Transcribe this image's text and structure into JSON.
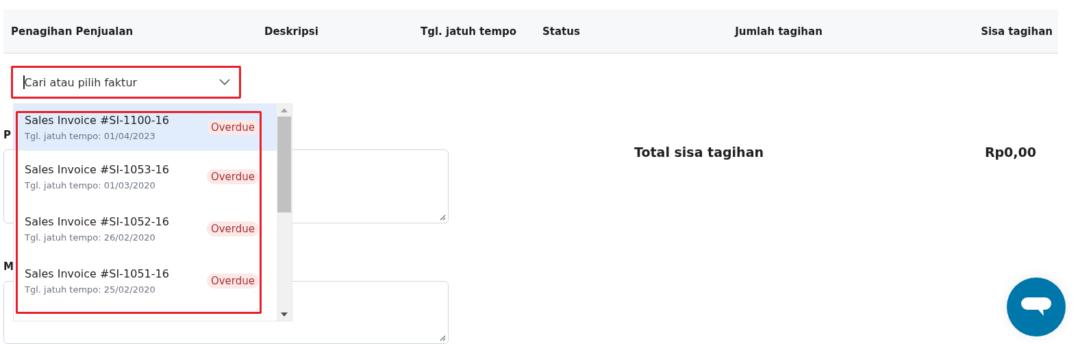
{
  "table": {
    "columns": [
      {
        "label": "Penagihan Penjualan"
      },
      {
        "label": "Deskripsi"
      },
      {
        "label": "Tgl. jatuh tempo"
      },
      {
        "label": "Status"
      },
      {
        "label": "Jumlah tagihan"
      },
      {
        "label": "Sisa tagihan"
      }
    ]
  },
  "invoice_select": {
    "placeholder": "Cari atau pilih faktur",
    "focused": true,
    "expanded": true
  },
  "dropdown": {
    "items": [
      {
        "title": "Sales Invoice #SI-1100-16",
        "due": "Tgl. jatuh tempo: 01/04/2023",
        "status": "Overdue",
        "selected": true
      },
      {
        "title": "Sales Invoice #SI-1053-16",
        "due": "Tgl. jatuh tempo: 01/03/2020",
        "status": "Overdue",
        "selected": false
      },
      {
        "title": "Sales Invoice #SI-1052-16",
        "due": "Tgl. jatuh tempo: 26/02/2020",
        "status": "Overdue",
        "selected": false
      },
      {
        "title": "Sales Invoice #SI-1051-16",
        "due": "Tgl. jatuh tempo: 25/02/2020",
        "status": "Overdue",
        "selected": false
      }
    ]
  },
  "form_fields": [
    {
      "label": "P"
    },
    {
      "label": "M"
    }
  ],
  "total": {
    "label": "Total sisa tagihan",
    "value": "Rp0,00"
  }
}
